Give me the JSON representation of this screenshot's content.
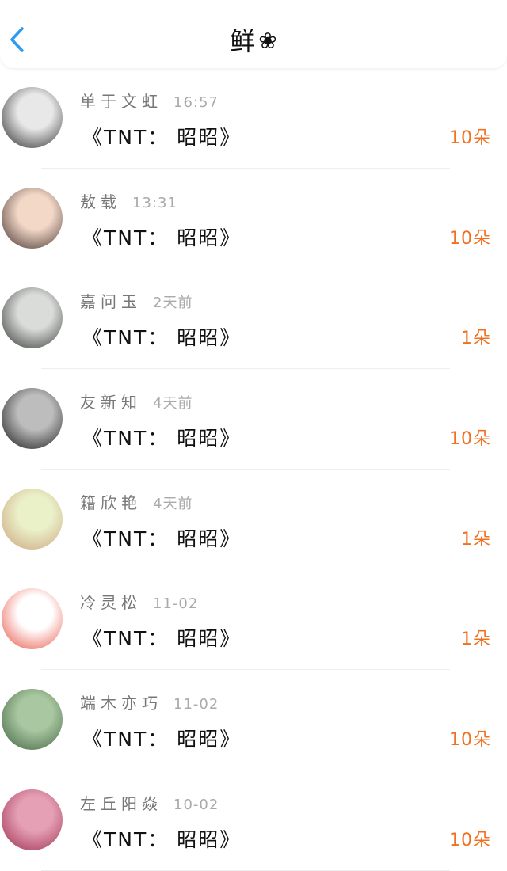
{
  "header": {
    "title": "鲜",
    "flower_icon": "❀"
  },
  "items": [
    {
      "name": "单于文虹",
      "time": "16:57",
      "message": "《TNT： 昭昭》",
      "amount": "10朵",
      "avatar_colors": [
        "#e8e8e8",
        "#222222"
      ]
    },
    {
      "name": "敖载",
      "time": "13:31",
      "message": "《TNT： 昭昭》",
      "amount": "10朵",
      "avatar_colors": [
        "#f3d8c8",
        "#3a2a25"
      ]
    },
    {
      "name": "嘉问玉",
      "time": "2天前",
      "message": "《TNT： 昭昭》",
      "amount": "1朵",
      "avatar_colors": [
        "#d9dcd8",
        "#2f2f2f"
      ]
    },
    {
      "name": "友新知",
      "time": "4天前",
      "message": "《TNT： 昭昭》",
      "amount": "10朵",
      "avatar_colors": [
        "#bdbdbd",
        "#111111"
      ]
    },
    {
      "name": "籍欣艳",
      "time": "4天前",
      "message": "《TNT： 昭昭》",
      "amount": "1朵",
      "avatar_colors": [
        "#eaf0c8",
        "#caa07a"
      ]
    },
    {
      "name": "冷灵松",
      "time": "11-02",
      "message": "《TNT： 昭昭》",
      "amount": "1朵",
      "avatar_colors": [
        "#ffffff",
        "#e84a3a"
      ]
    },
    {
      "name": "端木亦巧",
      "time": "11-02",
      "message": "《TNT： 昭昭》",
      "amount": "10朵",
      "avatar_colors": [
        "#a9c7a1",
        "#3b5f3b"
      ]
    },
    {
      "name": "左丘阳焱",
      "time": "10-02",
      "message": "《TNT： 昭昭》",
      "amount": "10朵",
      "avatar_colors": [
        "#e5a0b5",
        "#9b2a4a"
      ]
    }
  ]
}
